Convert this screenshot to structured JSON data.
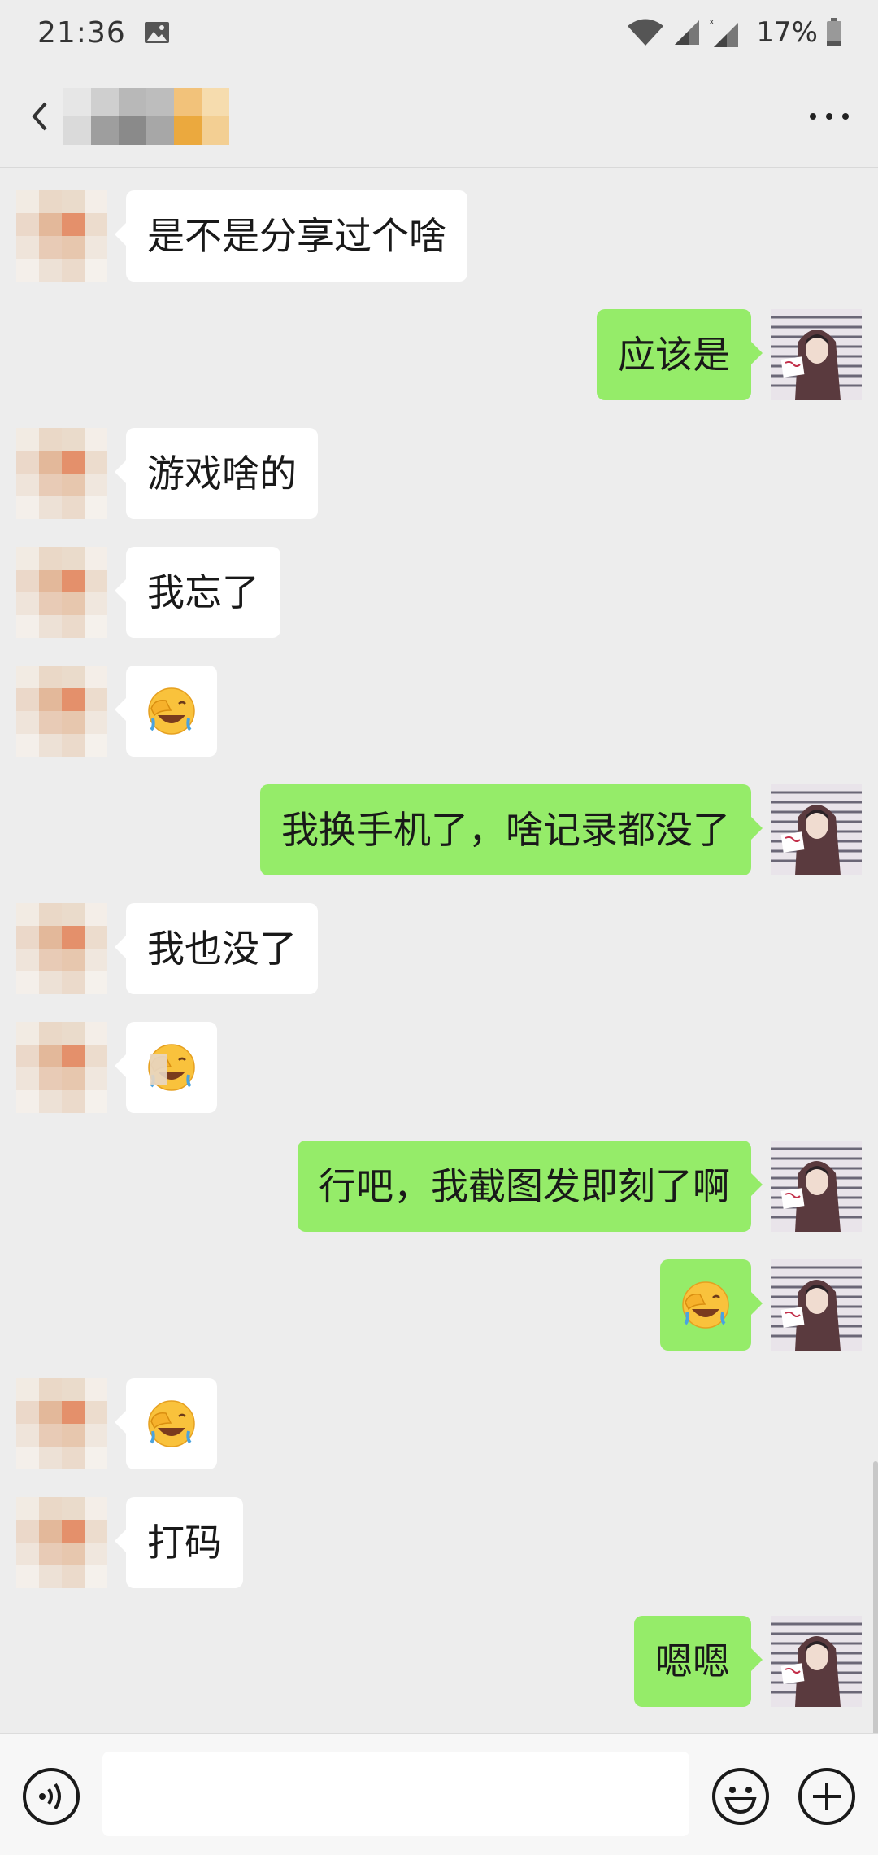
{
  "status_bar": {
    "time": "21:36",
    "battery": "17%",
    "icons": [
      "gallery-icon",
      "wifi-icon",
      "signal-icon",
      "signal-icon",
      "battery-icon"
    ]
  },
  "header": {
    "back_icon": "back-icon",
    "contact_name_state": "pixelated",
    "more_icon": "more-icon"
  },
  "messages": [
    {
      "side": "left",
      "type": "text",
      "text": "是不是分享过个啥"
    },
    {
      "side": "right",
      "type": "text",
      "text": "应该是"
    },
    {
      "side": "left",
      "type": "text",
      "text": "游戏啥的"
    },
    {
      "side": "left",
      "type": "text",
      "text": "我忘了"
    },
    {
      "side": "left",
      "type": "emoji",
      "emoji": "facepalm-emoji"
    },
    {
      "side": "right",
      "type": "text",
      "text": "我换手机了，啥记录都没了"
    },
    {
      "side": "left",
      "type": "text",
      "text": "我也没了"
    },
    {
      "side": "left",
      "type": "emoji",
      "emoji": "facepalm-emoji"
    },
    {
      "side": "right",
      "type": "text",
      "text": "行吧，我截图发即刻了啊"
    },
    {
      "side": "right",
      "type": "emoji",
      "emoji": "facepalm-emoji"
    },
    {
      "side": "left",
      "type": "emoji",
      "emoji": "facepalm-emoji"
    },
    {
      "side": "left",
      "type": "text",
      "text": "打码"
    },
    {
      "side": "right",
      "type": "text",
      "text": "嗯嗯"
    }
  ],
  "input_bar": {
    "voice_icon": "voice-icon",
    "input_value": "",
    "emoji_icon": "emoji-icon",
    "plus_icon": "plus-icon"
  },
  "colors": {
    "background": "#ededed",
    "bubble_self": "#95ec69",
    "bubble_other": "#ffffff",
    "text": "#191919"
  }
}
